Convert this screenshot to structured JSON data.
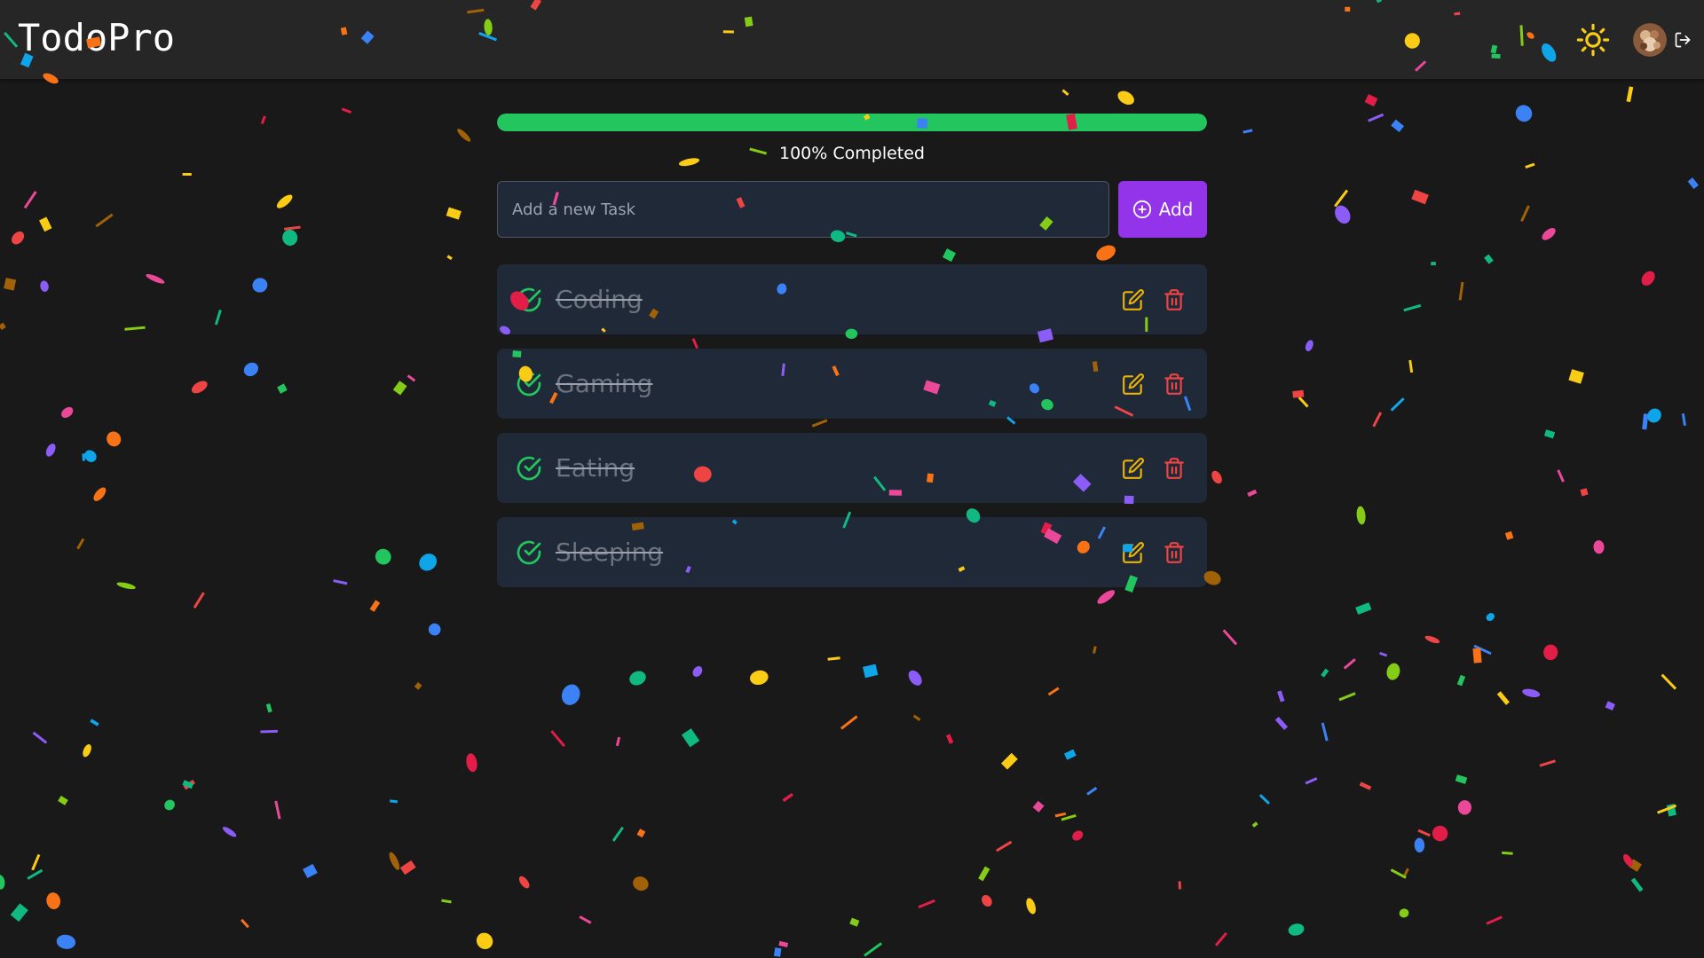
{
  "app": {
    "brand": "TodoPro"
  },
  "navbar": {
    "theme_icon": "sun-icon",
    "avatar_icon": "user-avatar",
    "logout_icon": "logout-icon"
  },
  "progress": {
    "percent": 100,
    "label": "100% Completed",
    "color": "#22c55e"
  },
  "add_task": {
    "placeholder": "Add a new Task",
    "value": "",
    "button_label": "Add",
    "button_icon": "plus-circle-icon",
    "button_color": "#9333ea"
  },
  "tasks": [
    {
      "title": "Coding",
      "completed": true
    },
    {
      "title": "Gaming",
      "completed": true
    },
    {
      "title": "Eating",
      "completed": true
    },
    {
      "title": "Sleeping",
      "completed": true
    }
  ],
  "task_icons": {
    "check": "check-circle-icon",
    "edit": "edit-icon",
    "delete": "trash-icon"
  },
  "colors": {
    "background": "#191919",
    "navbar": "#262626",
    "card": "#1f2937",
    "check": "#22c55e",
    "edit": "#eab308",
    "delete": "#ef4444",
    "theme_icon": "#facc15"
  }
}
